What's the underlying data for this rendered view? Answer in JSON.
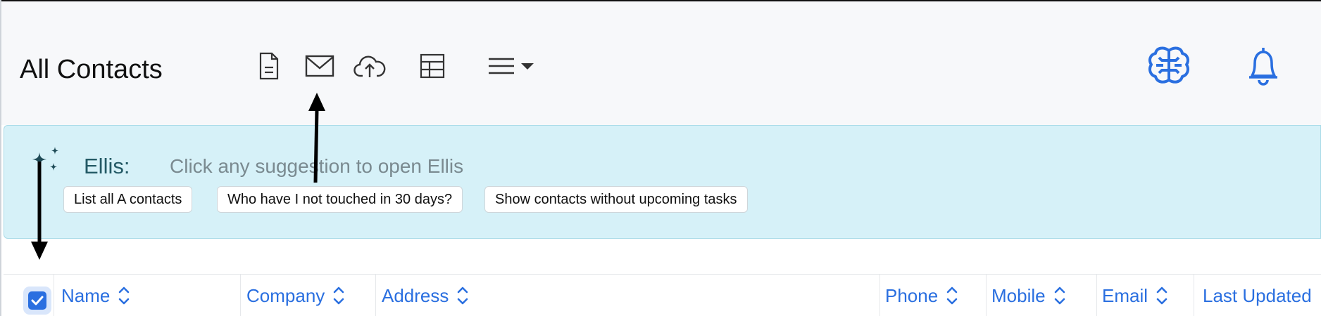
{
  "header": {
    "title": "All Contacts"
  },
  "toolbar": {
    "icons": [
      "document-icon",
      "mail-icon",
      "cloud-upload-icon",
      "table-icon",
      "menu-icon",
      "caret-down-icon"
    ]
  },
  "right_icons": [
    "brain-icon",
    "bell-icon"
  ],
  "assistant": {
    "name": "Ellis:",
    "hint": "Click any suggestion to open Ellis",
    "suggestions": [
      "List all A contacts",
      "Who have I not touched in 30 days?",
      "Show contacts without upcoming tasks"
    ]
  },
  "table": {
    "select_all_checked": true,
    "columns": [
      "Name",
      "Company",
      "Address",
      "Phone",
      "Mobile",
      "Email",
      "Last Updated"
    ]
  },
  "colors": {
    "accent": "#2a6fe0",
    "banner_bg": "#d6f1f8",
    "header_bg": "#f7f8fa"
  }
}
